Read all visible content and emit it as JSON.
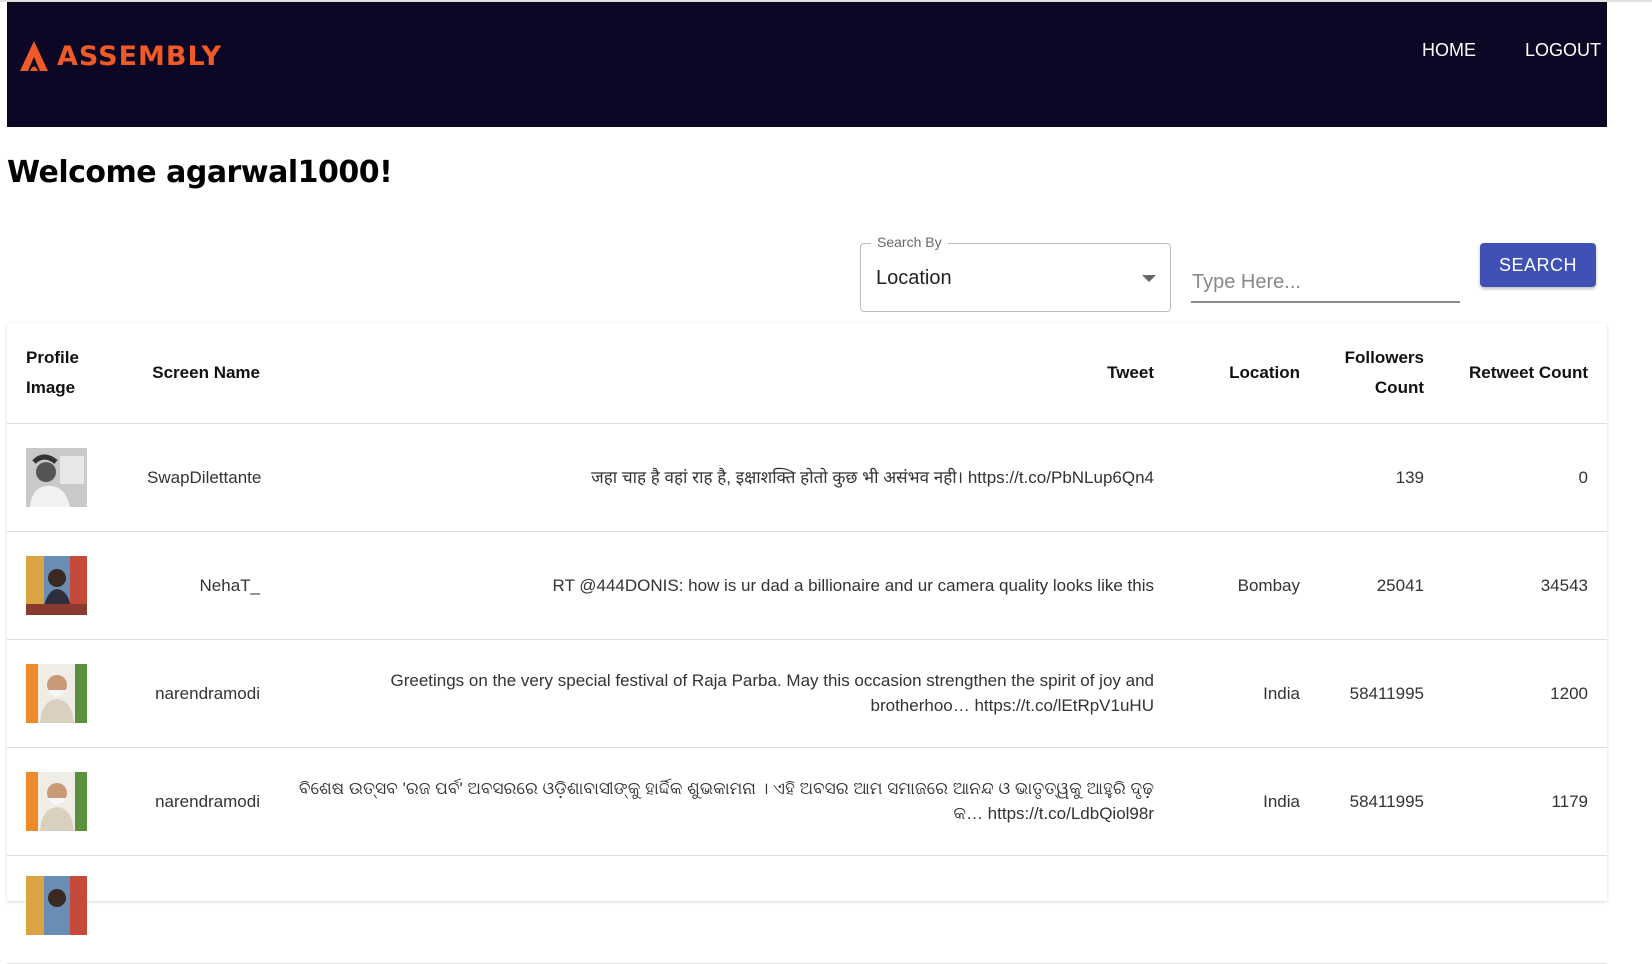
{
  "brand": {
    "name": "ASSEMBLY",
    "color": "#f05a28"
  },
  "nav": {
    "home": "HOME",
    "logout": "LOGOUT"
  },
  "welcome": "Welcome agarwal1000!",
  "search": {
    "by_label": "Search By",
    "by_value": "Location",
    "placeholder": "Type Here...",
    "button": "SEARCH"
  },
  "table": {
    "headers": {
      "profile": "Profile Image",
      "screen_name": "Screen Name",
      "tweet": "Tweet",
      "location": "Location",
      "followers": "Followers Count",
      "retweet": "Retweet Count"
    },
    "rows": [
      {
        "avatar_icon": "profile-photo-grayscale",
        "screen_name": "SwapDilettante",
        "tweet": "जहा चाह है वहां राह है, इक्षाशक्ति होतो कुछ भी असंभव नही। https://t.co/PbNLup6Qn4",
        "location": "",
        "followers": "139",
        "retweet": "0"
      },
      {
        "avatar_icon": "profile-photo-colorful",
        "screen_name": "NehaT_",
        "tweet": "RT @444DONIS: how is ur dad a billionaire and ur camera quality looks like this",
        "location": "Bombay",
        "followers": "25041",
        "retweet": "34543"
      },
      {
        "avatar_icon": "profile-photo-modi",
        "screen_name": "narendramodi",
        "tweet": "Greetings on the very special festival of Raja Parba. May this occasion strengthen the spirit of joy and brotherhoo… https://t.co/lEtRpV1uHU",
        "location": "India",
        "followers": "58411995",
        "retweet": "1200"
      },
      {
        "avatar_icon": "profile-photo-modi",
        "screen_name": "narendramodi",
        "tweet": "ବିଶେଷ ଉତ୍ସବ 'ରଜ ପର୍ବ' ଅବସରରେ ଓଡ଼ିଶାବାସୀଙ୍କୁ ହାର୍ଦ୍ଦିକ ଶୁଭକାମନା । ଏହି ଅବସର ଆମ ସମାଜରେ ଆନନ୍ଦ ଓ ଭାତୃତ୍ୱକୁ ଆହୁରି ଦୃଢ଼ କ… https://t.co/LdbQiol98r",
        "location": "India",
        "followers": "58411995",
        "retweet": "1179"
      },
      {
        "avatar_icon": "profile-photo-colorful",
        "screen_name": "",
        "tweet": "",
        "location": "",
        "followers": "",
        "retweet": ""
      }
    ]
  }
}
